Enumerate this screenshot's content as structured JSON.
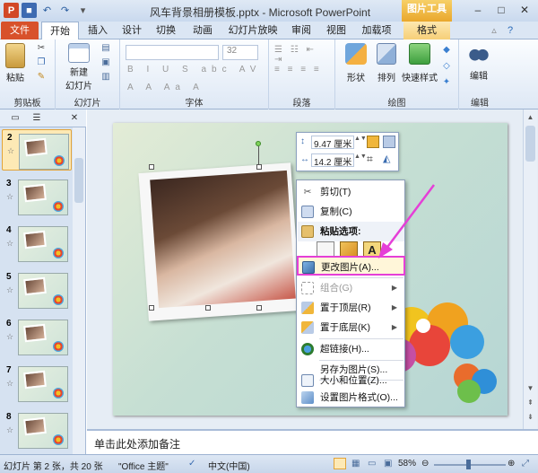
{
  "title_bar": {
    "doc_title": "风车背景相册模板.pptx - Microsoft PowerPoint",
    "context_tab": "图片工具"
  },
  "tabs": [
    "文件",
    "开始",
    "插入",
    "设计",
    "切换",
    "动画",
    "幻灯片放映",
    "审阅",
    "视图",
    "加载项",
    "格式"
  ],
  "ribbon": {
    "groups": [
      "剪贴板",
      "幻灯片",
      "字体",
      "段落",
      "绘图",
      "编辑"
    ],
    "paste": "粘贴",
    "new_slide": "新建\n幻灯片",
    "new_slide_line1": "新建",
    "new_slide_line2": "幻灯片",
    "font_size": "32",
    "shape": "形状",
    "arrange": "排列",
    "quick_style": "快速样式",
    "edit": "编辑"
  },
  "thumbnails": [
    {
      "num": "2",
      "selected": true
    },
    {
      "num": "3",
      "selected": false
    },
    {
      "num": "4",
      "selected": false
    },
    {
      "num": "5",
      "selected": false
    },
    {
      "num": "6",
      "selected": false
    },
    {
      "num": "7",
      "selected": false
    },
    {
      "num": "8",
      "selected": false
    }
  ],
  "size_toolbar": {
    "height": "9.47 厘米",
    "width": "14.2 厘米"
  },
  "context_menu": {
    "cut": "剪切(T)",
    "copy": "复制(C)",
    "paste_options": "粘贴选项:",
    "change_picture": "更改图片(A)...",
    "group": "组合(G)",
    "bring_front": "置于顶层(R)",
    "send_back": "置于底层(K)",
    "hyperlink": "超链接(H)...",
    "save_as_picture": "另存为图片(S)...",
    "size_position": "大小和位置(Z)...",
    "format_picture": "设置图片格式(O)..."
  },
  "notes_placeholder": "单击此处添加备注",
  "status": {
    "slide_info": "幻灯片 第 2 张，共 20 张",
    "theme": "\"Office 主题\"",
    "language": "中文(中国)",
    "zoom": "58%"
  },
  "colors": {
    "file_tab": "#d8512b",
    "highlight": "#e53fd7",
    "context_tab": "#e9a72c"
  }
}
